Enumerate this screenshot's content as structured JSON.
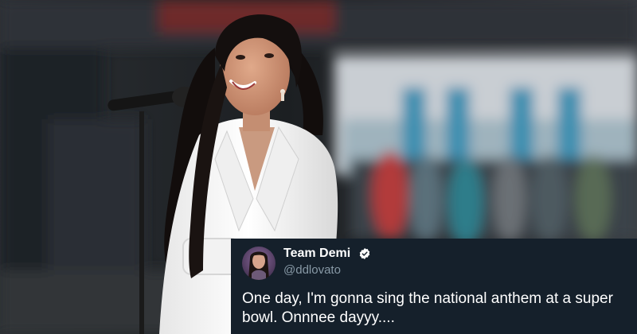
{
  "tweet": {
    "display_name": "Team Demi",
    "handle": "@ddlovato",
    "text": "One day, I'm gonna sing the national anthem at a super bowl. Onnnee dayyy....",
    "verified": true,
    "avatar_icon": "profile-photo",
    "verified_icon": "verified-badge-icon"
  },
  "colors": {
    "card_background": "#15202b",
    "name_text": "#ffffff",
    "handle_text": "#8899a6",
    "tweet_text": "#ffffff"
  }
}
